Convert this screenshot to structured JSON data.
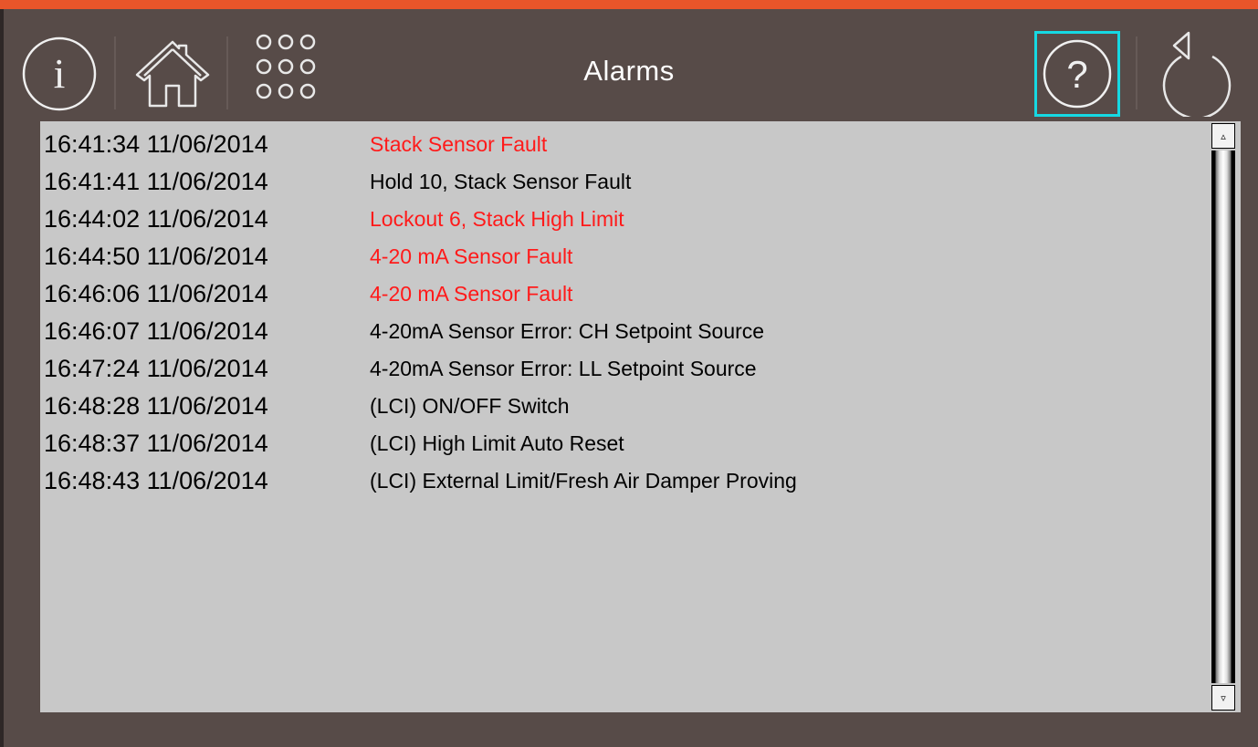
{
  "header": {
    "title": "Alarms",
    "icons": {
      "info": "info-icon",
      "home": "home-icon",
      "menu": "grid-menu-icon",
      "help": "help-icon",
      "back": "back-icon"
    },
    "help_label": "?",
    "info_label": "i"
  },
  "colors": {
    "accent": "#e8552a",
    "background": "#574b48",
    "panel": "#c8c8c8",
    "alarm_text": "#ff1a1a",
    "normal_text": "#000000",
    "focus_highlight": "#16d9e3"
  },
  "alarms": [
    {
      "time": "16:41:34 11/06/2014",
      "message": "Stack Sensor Fault",
      "severity": "alarm"
    },
    {
      "time": "16:41:41 11/06/2014",
      "message": "Hold 10, Stack Sensor Fault",
      "severity": "normal"
    },
    {
      "time": "16:44:02 11/06/2014",
      "message": "Lockout 6, Stack High Limit",
      "severity": "alarm"
    },
    {
      "time": "16:44:50 11/06/2014",
      "message": "4-20 mA Sensor Fault",
      "severity": "alarm"
    },
    {
      "time": "16:46:06 11/06/2014",
      "message": "4-20 mA Sensor Fault",
      "severity": "alarm"
    },
    {
      "time": "16:46:07 11/06/2014",
      "message": "4-20mA Sensor Error: CH Setpoint Source",
      "severity": "normal"
    },
    {
      "time": "16:47:24 11/06/2014",
      "message": "4-20mA Sensor Error: LL Setpoint Source",
      "severity": "normal"
    },
    {
      "time": "16:48:28 11/06/2014",
      "message": "(LCI) ON/OFF Switch",
      "severity": "normal"
    },
    {
      "time": "16:48:37 11/06/2014",
      "message": "(LCI) High Limit Auto Reset",
      "severity": "normal"
    },
    {
      "time": "16:48:43 11/06/2014",
      "message": "(LCI) External Limit/Fresh Air Damper Proving",
      "severity": "normal"
    }
  ],
  "scrollbar": {
    "up_glyph": "▵",
    "down_glyph": "▿"
  }
}
